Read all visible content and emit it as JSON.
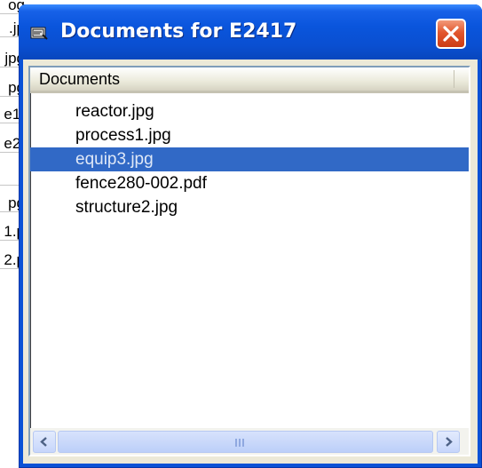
{
  "background_sheet": {
    "cells": [
      "og",
      ".jp",
      "jpg",
      "pg",
      "e1.",
      "e2.",
      "",
      "pg",
      "1.p",
      "2.p"
    ]
  },
  "window": {
    "title": "Documents for E2417",
    "icon": "folder-document-icon",
    "close_icon": "close-x-icon"
  },
  "list": {
    "column_header": "Documents",
    "items": [
      {
        "label": "reactor.jpg",
        "selected": false
      },
      {
        "label": "process1.jpg",
        "selected": false
      },
      {
        "label": "equip3.jpg",
        "selected": true
      },
      {
        "label": "fence280-002.pdf",
        "selected": false
      },
      {
        "label": "structure2.jpg",
        "selected": false
      }
    ]
  },
  "scrollbar": {
    "left_icon": "chevron-left-icon",
    "right_icon": "chevron-right-icon"
  },
  "colors": {
    "titlebar": "#0a4fd1",
    "selection": "#3169c6",
    "close_button": "#e2572e",
    "window_face": "#ece9d8"
  }
}
